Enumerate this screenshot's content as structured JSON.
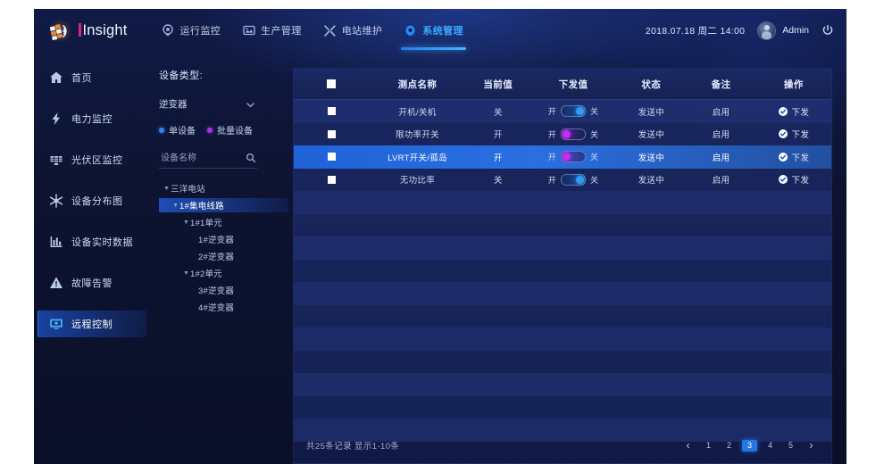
{
  "brand": {
    "name": "Insight",
    "logo_icon": "insight-logo-icon"
  },
  "header": {
    "nav": [
      {
        "label": "运行监控",
        "icon": "camera-circle-icon",
        "active": false
      },
      {
        "label": "生产管理",
        "icon": "panel-image-icon",
        "active": false
      },
      {
        "label": "电站维护",
        "icon": "wrench-icon",
        "active": false
      },
      {
        "label": "系统管理",
        "icon": "gear-icon",
        "active": true
      }
    ],
    "datetime": "2018.07.18 周二 14:00",
    "user": "Admin",
    "power_icon": "power-icon",
    "avatar_icon": "user-avatar"
  },
  "sidebar": {
    "items": [
      {
        "label": "首页",
        "icon": "home-icon",
        "active": false
      },
      {
        "label": "电力监控",
        "icon": "lightning-icon",
        "active": false
      },
      {
        "label": "光伏区监控",
        "icon": "solar-panel-icon",
        "active": false
      },
      {
        "label": "设备分布图",
        "icon": "network-nodes-icon",
        "active": false
      },
      {
        "label": "设备实时数据",
        "icon": "bar-chart-icon",
        "active": false
      },
      {
        "label": "故障告警",
        "icon": "warning-triangle-icon",
        "active": false
      },
      {
        "label": "远程控制",
        "icon": "remote-monitor-icon",
        "active": true
      }
    ]
  },
  "tree_panel": {
    "title": "设备类型:",
    "device_type_selected": "逆变器",
    "dropdown_icon": "chevron-down-icon",
    "modes": [
      {
        "label": "单设备",
        "color": "#2f86f0",
        "selected": true
      },
      {
        "label": "批量设备",
        "color": "#a634e8",
        "selected": false
      }
    ],
    "search_placeholder": "设备名称",
    "search_value": "",
    "search_icon": "search-icon",
    "tree": [
      {
        "label": "三洋电站",
        "level": 1,
        "caret": "▼",
        "selected": false
      },
      {
        "label": "1#集电线路",
        "level": 2,
        "caret": "▼",
        "selected": true
      },
      {
        "label": "1#1单元",
        "level": 3,
        "caret": "▼",
        "selected": false
      },
      {
        "label": "1#逆变器",
        "level": 4,
        "caret": "",
        "selected": false
      },
      {
        "label": "2#逆变器",
        "level": 4,
        "caret": "",
        "selected": false
      },
      {
        "label": "1#2单元",
        "level": 3,
        "caret": "▼",
        "selected": false
      },
      {
        "label": "3#逆变器",
        "level": 4,
        "caret": "",
        "selected": false
      },
      {
        "label": "4#逆变器",
        "level": 4,
        "caret": "",
        "selected": false
      }
    ]
  },
  "table": {
    "columns": [
      "",
      "测点名称",
      "当前值",
      "下发值",
      "状态",
      "备注",
      "操作"
    ],
    "rows": [
      {
        "checked": false,
        "name": "开机/关机",
        "current": "关",
        "toggle": {
          "on_label": "开",
          "off_label": "关",
          "position": "right",
          "color": "#2f9cf5"
        },
        "status": "发送中",
        "remark": "启用",
        "action": {
          "label": "下发",
          "icon": "check-circle-icon"
        },
        "highlight": false
      },
      {
        "checked": false,
        "name": "限功率开关",
        "current": "开",
        "toggle": {
          "on_label": "开",
          "off_label": "关",
          "position": "left",
          "color": "#c12ef0"
        },
        "status": "发送中",
        "remark": "启用",
        "action": {
          "label": "下发",
          "icon": "check-circle-icon"
        },
        "highlight": false
      },
      {
        "checked": false,
        "name": "LVRT开关/孤岛",
        "current": "开",
        "toggle": {
          "on_label": "开",
          "off_label": "关",
          "position": "left",
          "color": "#c12ef0"
        },
        "status": "发送中",
        "remark": "启用",
        "action": {
          "label": "下发",
          "icon": "check-circle-icon"
        },
        "highlight": true
      },
      {
        "checked": false,
        "name": "无功比率",
        "current": "关",
        "toggle": {
          "on_label": "开",
          "off_label": "关",
          "position": "right",
          "color": "#2f9cf5"
        },
        "status": "发送中",
        "remark": "启用",
        "action": {
          "label": "下发",
          "icon": "check-circle-icon"
        },
        "highlight": false
      }
    ],
    "empty_row_count": 11,
    "footer": {
      "record_info": "共25条记录   显示1-10条",
      "prev_icon": "chevron-left-icon",
      "next_icon": "chevron-right-icon",
      "pages": [
        "1",
        "2",
        "3",
        "4",
        "5"
      ],
      "active_page": "3"
    }
  },
  "colors": {
    "accent_blue": "#2277e6",
    "accent_magenta": "#e0218a",
    "toggle_purple": "#c12ef0",
    "toggle_blue": "#2f9cf5",
    "panel_bg": "#182449",
    "app_bg": "#0d1330"
  }
}
